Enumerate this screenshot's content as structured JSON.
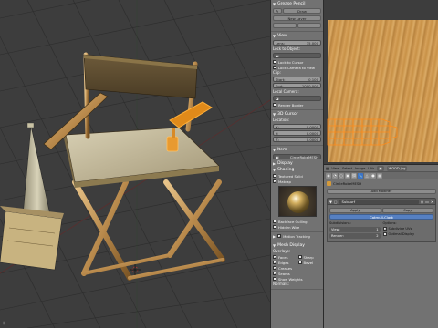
{
  "npanel": {
    "grease_pencil": {
      "title": "Grease Pencil",
      "draw": "Draw",
      "new_layer": "New Layer"
    },
    "view": {
      "title": "View",
      "lens_label": "Lens:",
      "lens_value": "35.000",
      "lock_to_object": "Lock to Object:",
      "lock_to_cursor": "Lock to Cursor",
      "lock_camera_to_view": "Lock Camera to View",
      "clip_label": "Clip:",
      "clip_start_label": "Start:",
      "clip_start_value": "0.100",
      "clip_end_label": "End:",
      "clip_end_value": "1000.000",
      "local_camera": "Local Camera:",
      "render_border": "Render Border"
    },
    "cursor": {
      "title": "3D Cursor",
      "location_label": "Location:",
      "x_label": "X:",
      "x_value": "0.0000",
      "y_label": "Y:",
      "y_value": "0.0000",
      "z_label": "Z:",
      "z_value": "0.0000"
    },
    "item": {
      "title": "Item",
      "name": "CircleRobeMESH",
      "display_title": "Display",
      "shading_title": "Shading"
    },
    "shading": {
      "textured_solid": "Textured Solid",
      "matcap": "Matcap",
      "backface_culling": "Backface Culling",
      "hidden_wire": "Hidden Wire"
    },
    "motion_tracking": "Motion Tracking",
    "mesh_display": {
      "title": "Mesh Display",
      "overlays_label": "Overlays:",
      "faces": "Faces",
      "sharp": "Sharp",
      "edges": "Edges",
      "bevel": "Bevel",
      "creases": "Creases",
      "seams": "Seams",
      "show_weights": "Show Weights",
      "normals": "Normals:"
    }
  },
  "uv_header": {
    "view": "View",
    "select": "Select",
    "image": "Image",
    "uvs": "UVs",
    "image_name": "WOOD.jpg"
  },
  "properties": {
    "object_name": "CircleRobeMESH",
    "add_modifier": "Add Modifier",
    "modifier_name": "Subsurf",
    "apply_label": "Apply",
    "copy_label": "Copy",
    "mode": "Catmull-Clark",
    "subdivisions_label": "Subdivisions:",
    "view_label": "View:",
    "view_value": "1",
    "render_label": "Render:",
    "render_value": "2",
    "options_label": "Options:",
    "subdivide_uvs": "Subdivide UVs",
    "optimal_display": "Optimal Display"
  }
}
